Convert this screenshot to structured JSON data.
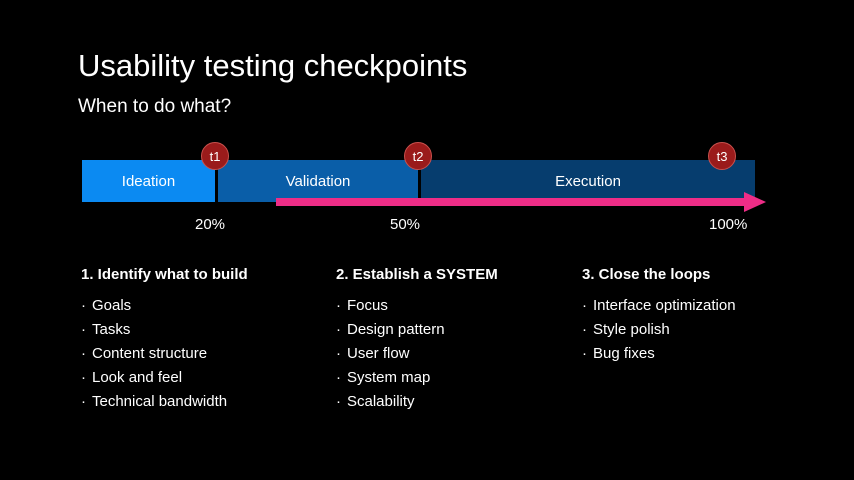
{
  "slide": {
    "title": "Usability testing checkpoints",
    "subtitle": "When to do what?"
  },
  "timeline": {
    "phases": [
      {
        "label": "Ideation",
        "color": "#0b8af2"
      },
      {
        "label": "Validation",
        "color": "#0a5ea8"
      },
      {
        "label": "Execution",
        "color": "#063d6e"
      }
    ],
    "checkpoints": [
      "t1",
      "t2",
      "t3"
    ],
    "percentages": [
      "20%",
      "50%",
      "100%"
    ],
    "arrow_color": "#ee2d87",
    "checkpoint_color": "#9a1b1b"
  },
  "columns": [
    {
      "heading": "1. Identify what to build",
      "items": [
        "Goals",
        "Tasks",
        "Content structure",
        "Look and feel",
        "Technical bandwidth"
      ]
    },
    {
      "heading": "2. Establish a SYSTEM",
      "items": [
        "Focus",
        "Design pattern",
        "User flow",
        "System map",
        "Scalability"
      ]
    },
    {
      "heading": "3. Close the loops",
      "items": [
        "Interface optimization",
        "Style polish",
        "Bug fixes"
      ]
    }
  ]
}
